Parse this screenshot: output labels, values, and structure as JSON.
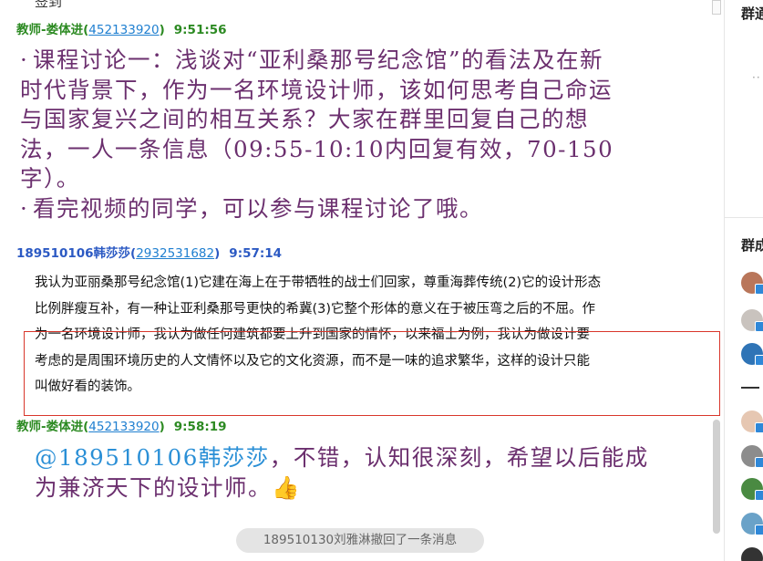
{
  "chat": {
    "top_fragment": "签到",
    "messages": [
      {
        "sender": "教师-娄体进",
        "qq": "452133920",
        "time": "9:51:56",
        "role": "teacher",
        "lines": [
          "课程讨论一：浅谈对“亚利桑那号纪念馆”的看法及在新",
          "时代背景下，作为一名环境设计师，该如何思考自己命运",
          "与国家复兴之间的相互关系？大家在群里回复自己的想",
          "法，一人一条信息（09:55-10:10内回复有效，70-150",
          "字）。"
        ],
        "line2": "看完视频的同学，可以参与课程讨论了哦。"
      },
      {
        "sender": "189510106韩莎莎",
        "qq": "2932531682",
        "time": "9:57:14",
        "role": "student",
        "lines": [
          "我认为亚丽桑那号纪念馆(1)它建在海上在于带牺牲的战士们回家，尊重海葬传统(2)它的设计形态",
          "比例胖瘦互补，有一种让亚利桑那号更快的希冀(3)它整个形体的意义在于被压弯之后的不屈。作",
          "为一名环境设计师，我认为做任何建筑都要上升到国家的情怀，以来福士为例，我认为做设计要",
          "考虑的是周围环境历史的人文情怀以及它的文化资源，而不是一味的追求繁华，这样的设计只能",
          "叫做好看的装饰。"
        ]
      },
      {
        "sender": "教师-娄体进",
        "qq": "452133920",
        "time": "9:58:19",
        "role": "teacher",
        "mention": "@189510106韩莎莎",
        "text_after_mention": "，不错，认知很深刻，希望以后能成",
        "line2": "为兼济天下的设计师。",
        "emoji": "👍"
      }
    ],
    "recall_notice": "189510130刘雅淋撤回了一条消息"
  },
  "side_panel": {
    "title_top": "群通",
    "title_members": "群成"
  },
  "colors": {
    "teacher_name": "#2c8a22",
    "student_name": "#2b59c3",
    "qq_link": "#1f7fd0",
    "big_text": "#6b2f6e",
    "mention": "#2a8fd6",
    "highlight_border": "#d9362b"
  }
}
